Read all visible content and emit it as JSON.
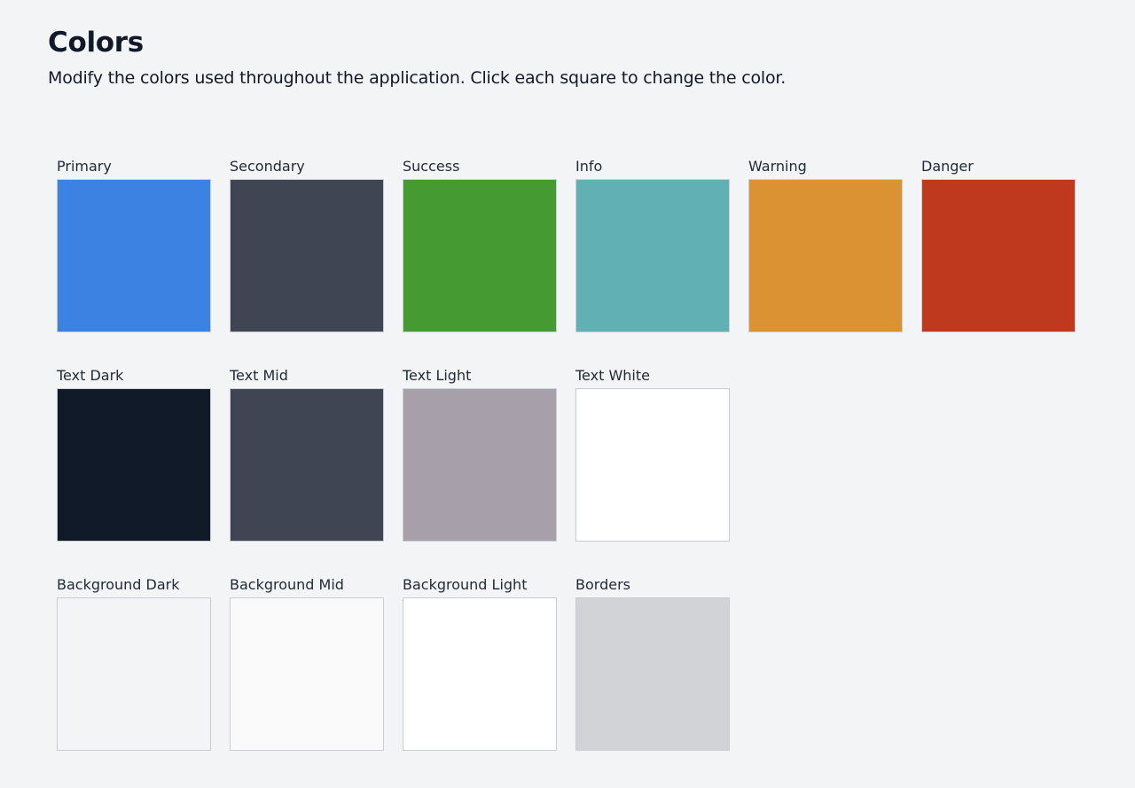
{
  "header": {
    "title": "Colors",
    "description": "Modify the colors used throughout the application. Click each square to change the color."
  },
  "rows": [
    [
      {
        "label": "Primary",
        "color": "#3b82e3"
      },
      {
        "label": "Secondary",
        "color": "#3f4552"
      },
      {
        "label": "Success",
        "color": "#459a31"
      },
      {
        "label": "Info",
        "color": "#61b0b3"
      },
      {
        "label": "Warning",
        "color": "#da9233"
      },
      {
        "label": "Danger",
        "color": "#bf391e"
      }
    ],
    [
      {
        "label": "Text Dark",
        "color": "#111a29"
      },
      {
        "label": "Text Mid",
        "color": "#3f4552"
      },
      {
        "label": "Text Light",
        "color": "#a7a0ab"
      },
      {
        "label": "Text White",
        "color": "#ffffff"
      }
    ],
    [
      {
        "label": "Background Dark",
        "color": "#f3f4f6"
      },
      {
        "label": "Background Mid",
        "color": "#fafafa"
      },
      {
        "label": "Background Light",
        "color": "#ffffff"
      },
      {
        "label": "Borders",
        "color": "#d2d3d7"
      }
    ]
  ]
}
